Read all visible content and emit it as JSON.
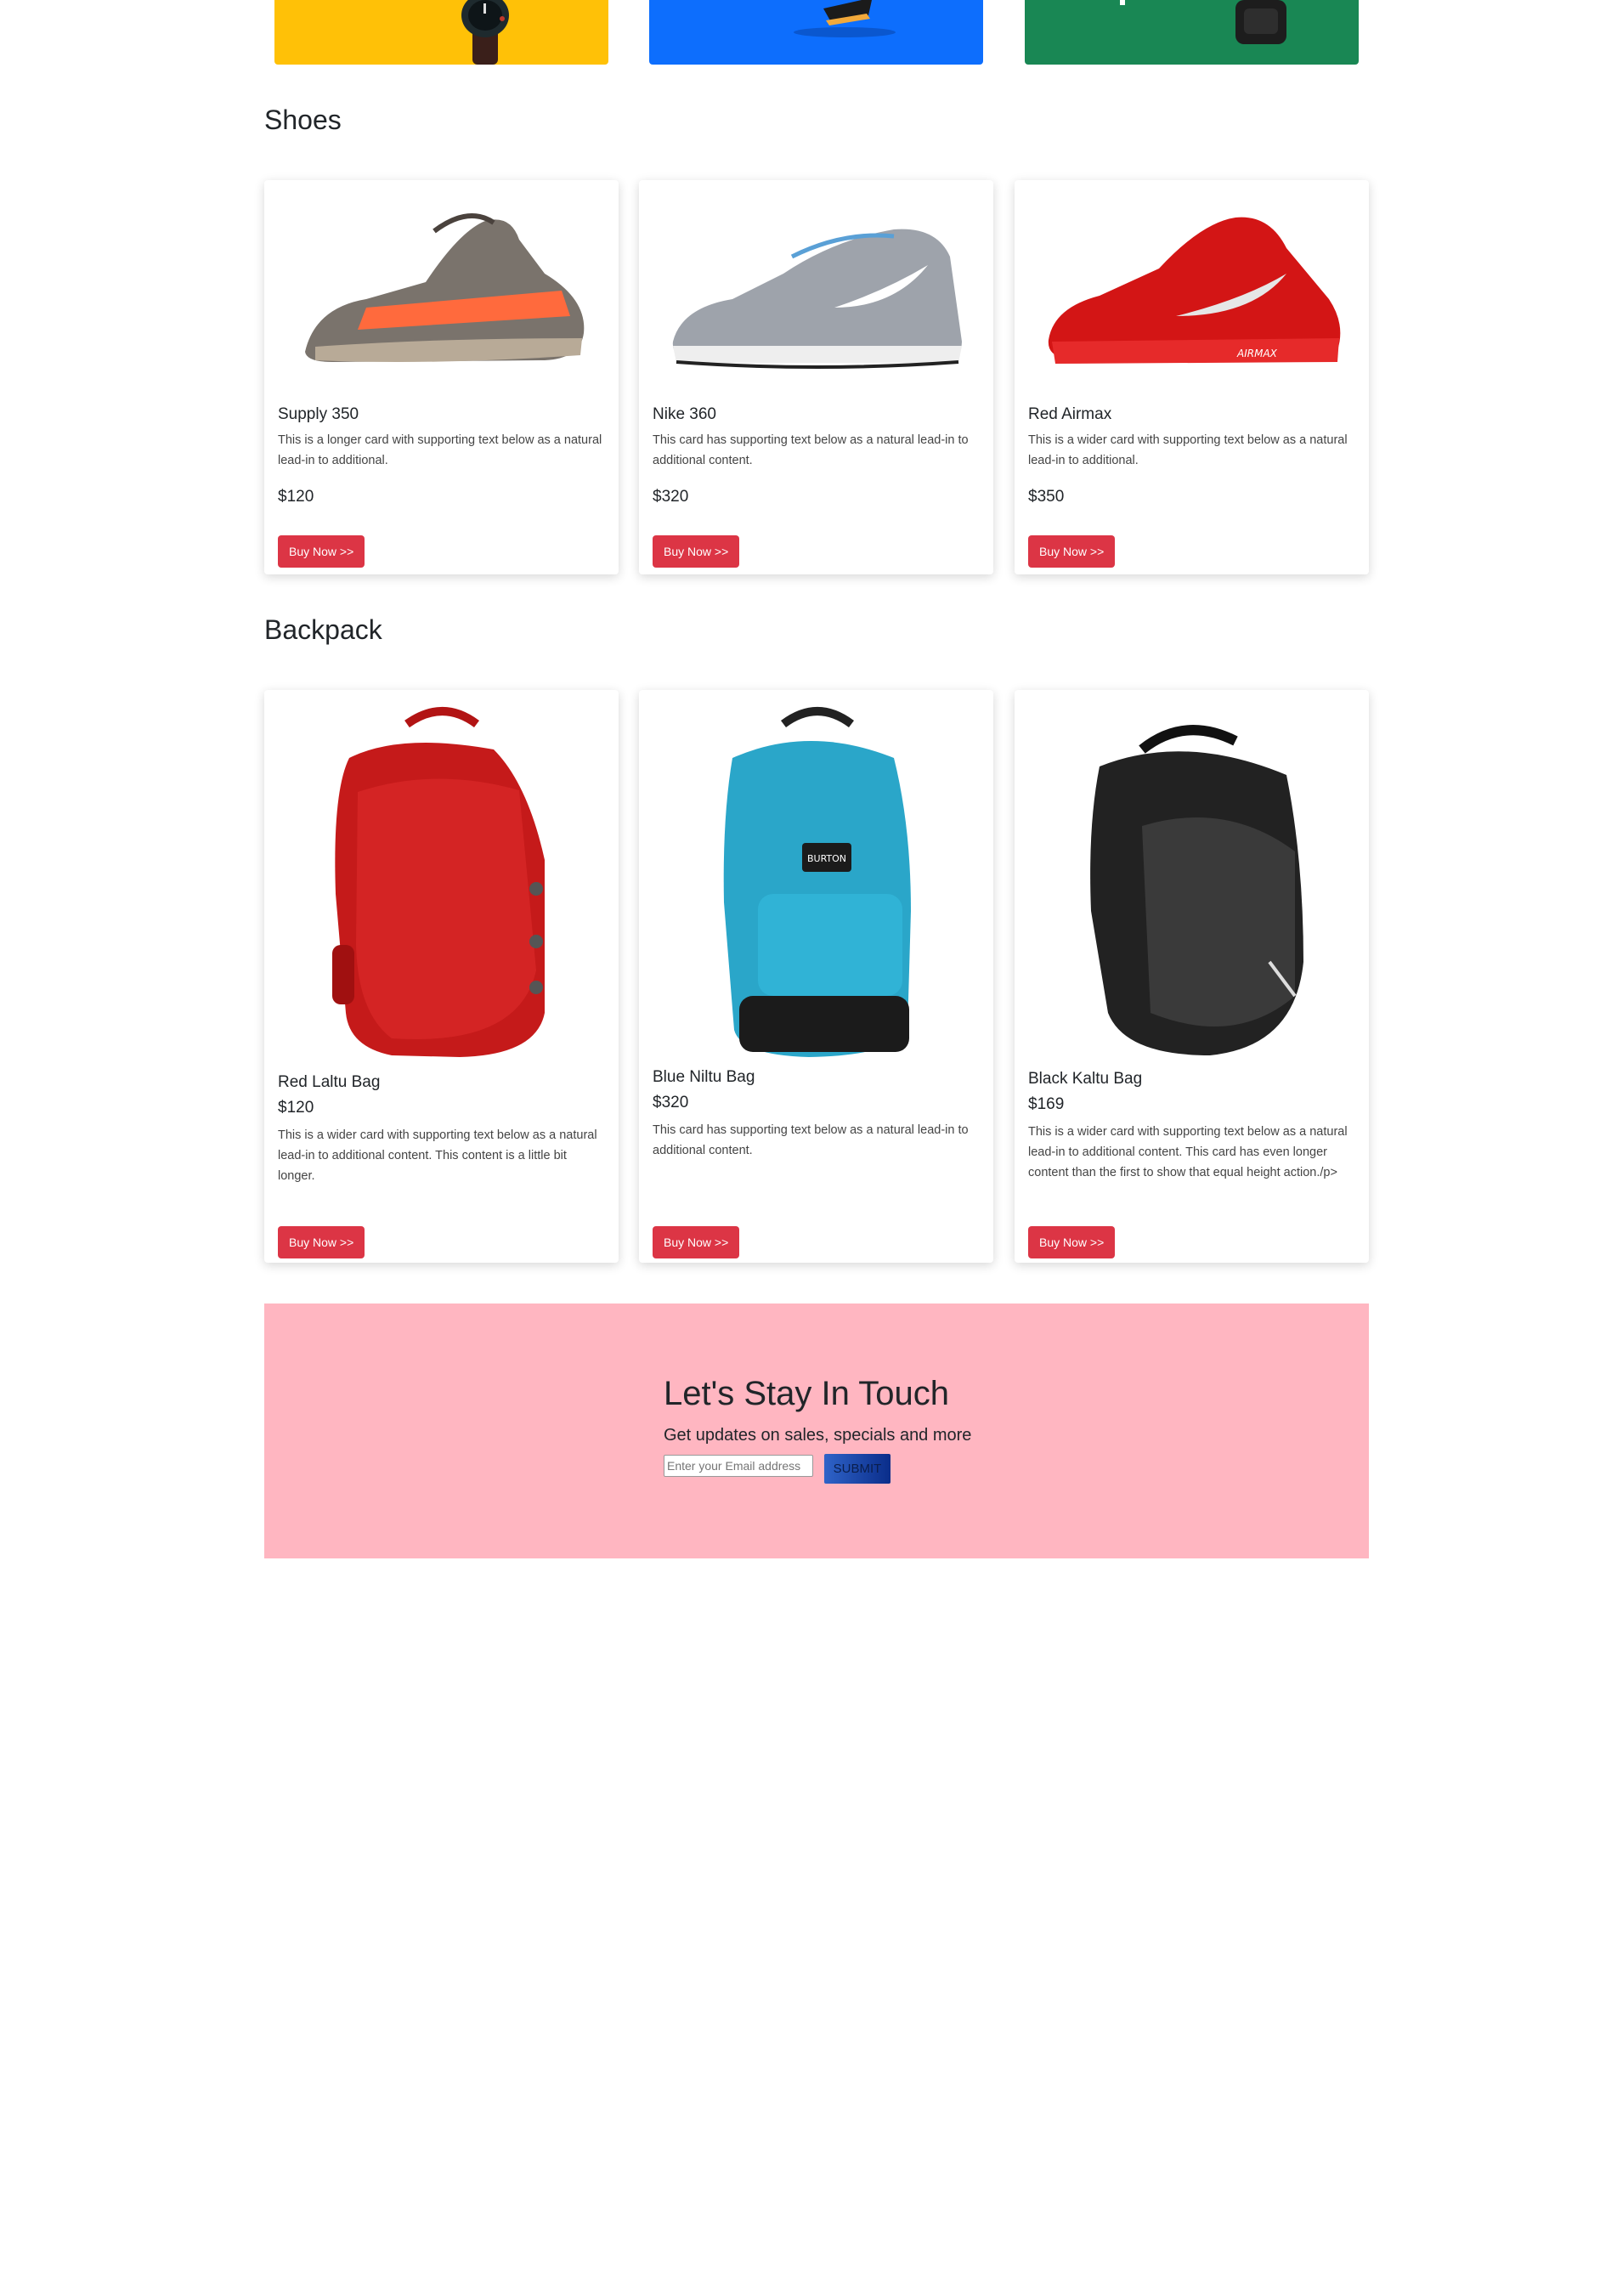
{
  "banners": [
    {
      "color": "#ffc107",
      "image": "wristwatch-product"
    },
    {
      "color": "#0d6efd",
      "image": "sneaker-product"
    },
    {
      "color": "#198754",
      "image": "backpack-product"
    }
  ],
  "shoes": {
    "title": "Shoes",
    "cards": [
      {
        "name": "Supply 350",
        "desc": "This is a longer card with supporting text below as a natural lead-in to additional.",
        "price": "$120",
        "button": "Buy Now >>",
        "image": "yeezy-sneaker"
      },
      {
        "name": "Nike 360",
        "desc": "This card has supporting text below as a natural lead-in to additional content.",
        "price": "$320",
        "button": "Buy Now >>",
        "image": "nike-pegasus-sneaker"
      },
      {
        "name": "Red Airmax",
        "desc": "This is a wider card with supporting text below as a natural lead-in to additional.",
        "price": "$350",
        "button": "Buy Now >>",
        "image": "red-airmax-sneaker"
      }
    ]
  },
  "backpack": {
    "title": "Backpack",
    "cards": [
      {
        "name": "Red Laltu Bag",
        "price": "$120",
        "desc": "This is a wider card with supporting text below as a natural lead-in to additional content. This content is a little bit longer.",
        "button": "Buy Now >>",
        "image": "red-backpack"
      },
      {
        "name": "Blue Niltu Bag",
        "price": "$320",
        "desc": "This card has supporting text below as a natural lead-in to additional content.",
        "button": "Buy Now >>",
        "image": "blue-backpack",
        "badge": "BURTON"
      },
      {
        "name": "Black Kaltu Bag",
        "price": "$169",
        "desc": "This is a wider card with supporting text below as a natural lead-in to additional content. This card has even longer content than the first to show that equal height action./p>",
        "button": "Buy Now >>",
        "image": "black-backpack"
      }
    ]
  },
  "newsletter": {
    "title": "Let's Stay In Touch",
    "subtitle": "Get updates on sales, specials and more",
    "placeholder": "Enter your Email address",
    "submit": "SUBMIT",
    "background": "#ffb6c1"
  },
  "colors": {
    "buy_button": "#dc3545"
  }
}
